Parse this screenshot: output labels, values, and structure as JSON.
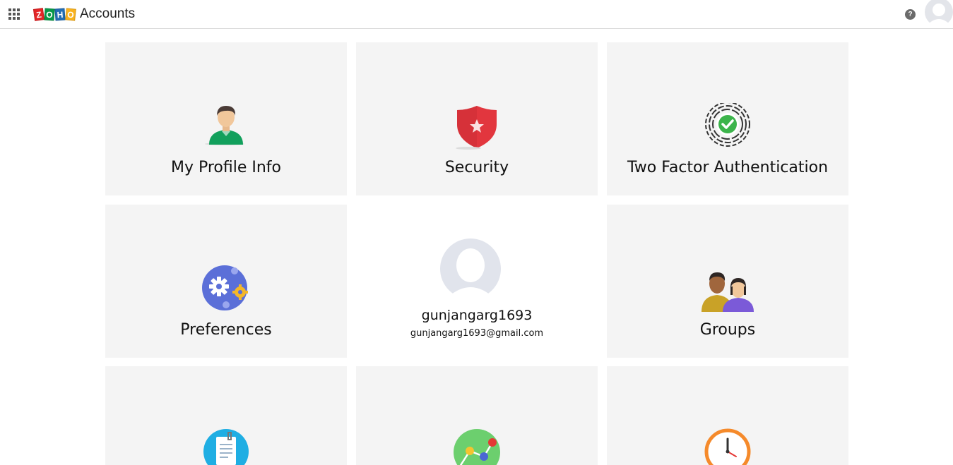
{
  "header": {
    "logo_letters": [
      "Z",
      "O",
      "H",
      "O"
    ],
    "app_title": "Accounts",
    "help_glyph": "?"
  },
  "tiles": [
    {
      "label": "My Profile Info",
      "icon": "person-icon"
    },
    {
      "label": "Security",
      "icon": "shield-star-icon"
    },
    {
      "label": "Two Factor Authentication",
      "icon": "fingerprint-check-icon"
    },
    {
      "label": "Preferences",
      "icon": "gears-icon"
    },
    {
      "label": "Groups",
      "icon": "group-users-icon"
    },
    {
      "label": "",
      "icon": "clipboard-icon"
    },
    {
      "label": "",
      "icon": "network-graph-icon"
    },
    {
      "label": "",
      "icon": "clock-icon"
    }
  ],
  "profile": {
    "username": "gunjangarg1693",
    "email": "gunjangarg1693@gmail.com"
  },
  "colors": {
    "tile_bg": "#f4f4f4",
    "shield_red": "#e2363e",
    "person_green": "#12a05c",
    "gear_blue": "#5b6fd8",
    "clock_orange": "#f58a2b"
  }
}
